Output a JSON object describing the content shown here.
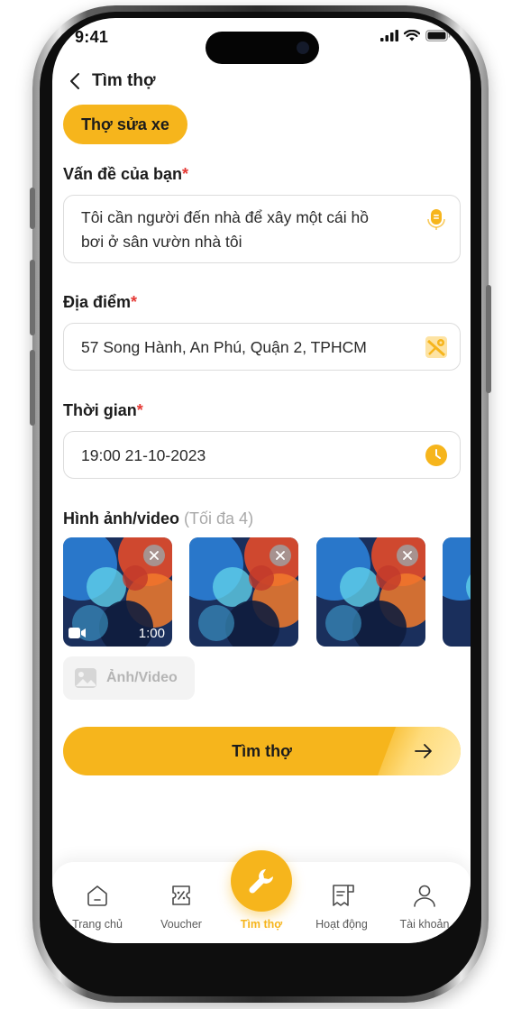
{
  "status_bar": {
    "time": "9:41"
  },
  "header": {
    "title": "Tìm thợ"
  },
  "category_chip": "Thợ sửa xe",
  "problem": {
    "label": "Vấn đề của bạn",
    "required_mark": "*",
    "line1": "Tôi cần người đến nhà để xây một cái hồ",
    "line2": "bơi ở sân vườn nhà tôi"
  },
  "location": {
    "label": "Địa điểm",
    "required_mark": "*",
    "value": "57 Song Hành, An Phú, Quận 2,  TPHCM"
  },
  "time": {
    "label": "Thời gian",
    "required_mark": "*",
    "value": "19:00  21-10-2023"
  },
  "media": {
    "label": "Hình ảnh/video",
    "hint": "(Tối đa 4)",
    "video_duration": "1:00",
    "add_label": "Ảnh/Video"
  },
  "submit": {
    "label": "Tìm thợ"
  },
  "bottom_nav": {
    "home": "Trang chủ",
    "voucher": "Voucher",
    "find": "Tìm thợ",
    "activity": "Hoạt động",
    "account": "Tài khoản"
  },
  "colors": {
    "accent": "#F6B51C",
    "required": "#E53935",
    "text": "#1C1C1C",
    "muted": "#A8A8A8"
  },
  "icons": [
    "back-icon",
    "microphone-icon",
    "map-icon",
    "clock-icon",
    "close-icon",
    "video-icon",
    "image-icon",
    "arrow-right-icon",
    "home-icon",
    "voucher-icon",
    "wrench-icon",
    "activity-icon",
    "account-icon"
  ]
}
